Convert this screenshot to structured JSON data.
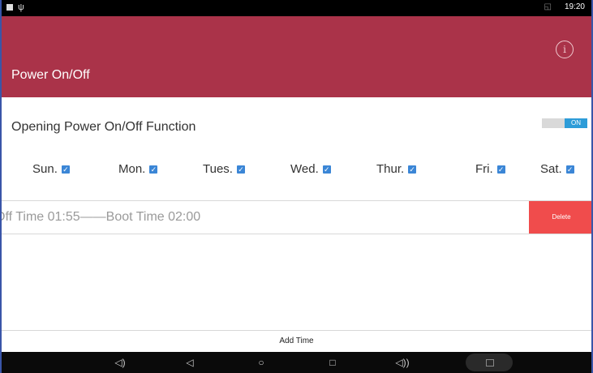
{
  "status_bar": {
    "time": "19:20"
  },
  "app_bar": {
    "title": "Power On/Off"
  },
  "function": {
    "label": "Opening Power On/Off Function",
    "toggle_label": "ON"
  },
  "days": [
    {
      "label": "Sun.",
      "checked": true
    },
    {
      "label": "Mon.",
      "checked": true
    },
    {
      "label": "Tues.",
      "checked": true
    },
    {
      "label": "Wed.",
      "checked": true
    },
    {
      "label": "Thur.",
      "checked": true
    },
    {
      "label": "Fri.",
      "checked": true
    },
    {
      "label": "Sat.",
      "checked": true
    }
  ],
  "schedule": {
    "entry_text": "Off Time  01:55——Boot Time 02:00",
    "delete_label": "Delete"
  },
  "add_time_label": "Add Time",
  "icons": {
    "info": "info-icon",
    "checkbox": "checkbox-checked-icon",
    "nav": [
      "volume-down-icon",
      "back-icon",
      "home-icon",
      "recent-apps-icon",
      "volume-up-icon",
      "screenshot-icon"
    ]
  },
  "colors": {
    "app_bar": "#aa3349",
    "toggle_on": "#2d9cd8",
    "delete": "#f04c4c",
    "checkbox": "#3b86d6"
  }
}
